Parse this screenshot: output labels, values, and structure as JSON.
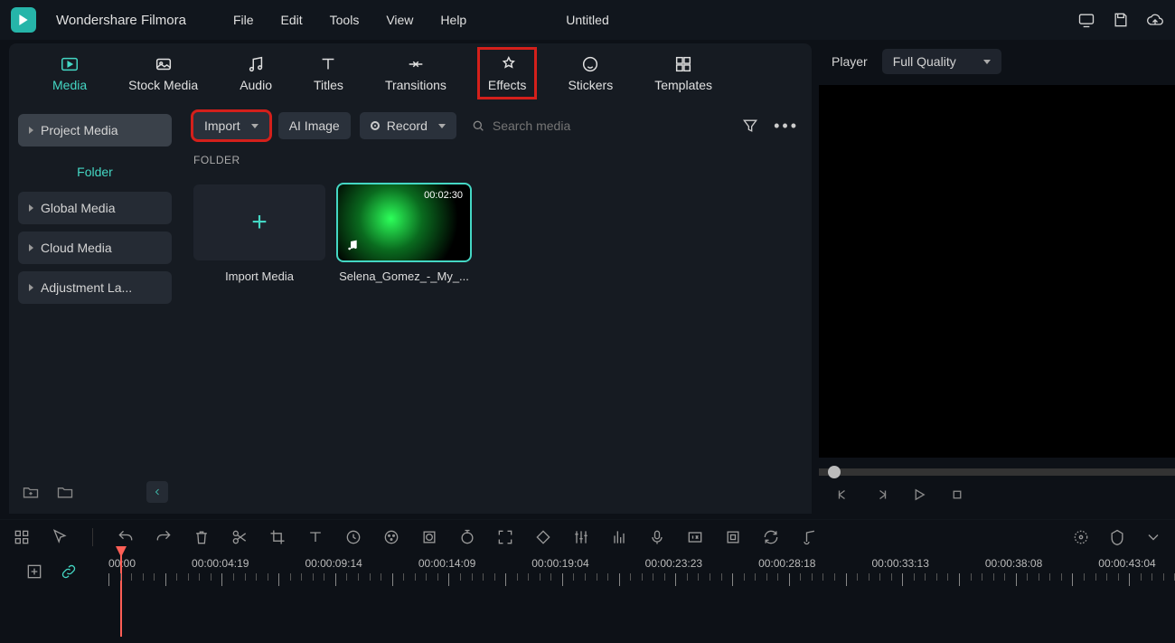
{
  "app": {
    "title": "Wondershare Filmora",
    "document": "Untitled"
  },
  "menu": [
    "File",
    "Edit",
    "Tools",
    "View",
    "Help"
  ],
  "tabs": [
    {
      "id": "media",
      "label": "Media",
      "active": true
    },
    {
      "id": "stock",
      "label": "Stock Media"
    },
    {
      "id": "audio",
      "label": "Audio"
    },
    {
      "id": "titles",
      "label": "Titles"
    },
    {
      "id": "transitions",
      "label": "Transitions"
    },
    {
      "id": "effects",
      "label": "Effects",
      "highlight": true
    },
    {
      "id": "stickers",
      "label": "Stickers"
    },
    {
      "id": "templates",
      "label": "Templates"
    }
  ],
  "sidebar": {
    "project_media": "Project Media",
    "folder": "Folder",
    "global_media": "Global Media",
    "cloud_media": "Cloud Media",
    "adjustment_layer": "Adjustment La..."
  },
  "toolbar": {
    "import": "Import",
    "ai_image": "AI Image",
    "record": "Record",
    "search_placeholder": "Search media"
  },
  "media": {
    "folder_header": "FOLDER",
    "import_media_label": "Import Media",
    "clip": {
      "label": "Selena_Gomez_-_My_...",
      "duration": "00:02:30"
    }
  },
  "player": {
    "label": "Player",
    "quality": "Full Quality"
  },
  "timeline": {
    "times": [
      "00:00",
      "00:00:04:19",
      "00:00:09:14",
      "00:00:14:09",
      "00:00:19:04",
      "00:00:23:23",
      "00:00:28:18",
      "00:00:33:13",
      "00:00:38:08",
      "00:00:43:04"
    ]
  }
}
